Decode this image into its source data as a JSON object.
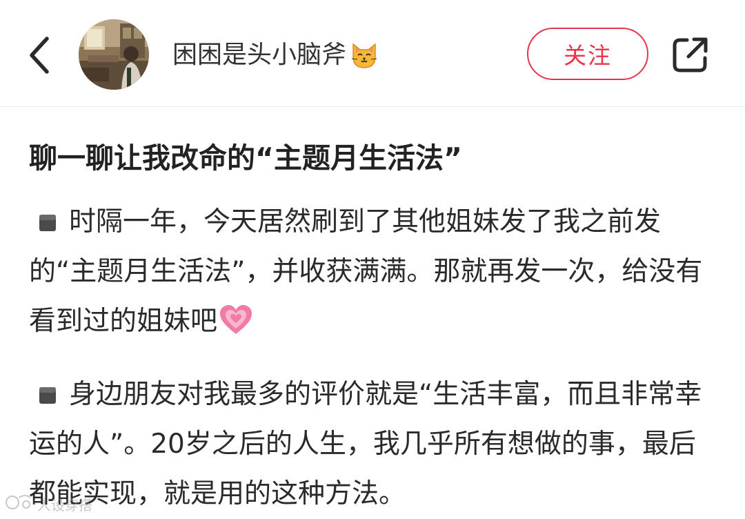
{
  "header": {
    "author_name": "困困是头小脑斧",
    "author_emoji_icon": "cat-face-icon",
    "follow_label": "关注",
    "accent_color": "#e8344a"
  },
  "post": {
    "title": "聊一聊让我改命的“主题月生活法”",
    "paragraphs": [
      {
        "bullet_icon": "black-square-icon",
        "text": "时隔一年，今天居然刷到了其他姐妹发了我之前发的“主题月生活法”，并收获满满。那就再发一次，给没有看到过的姐妹吧",
        "trailing_icon": "pink-heart-icon"
      },
      {
        "bullet_icon": "black-square-icon",
        "text": "身边朋友对我最多的评价就是“生活丰富，而且非常幸运的人”。20岁之后的人生，我几乎所有想做的事，最后都能实现，就是用的这种方法。"
      }
    ]
  },
  "watermark": {
    "text": "人设穿搭"
  }
}
